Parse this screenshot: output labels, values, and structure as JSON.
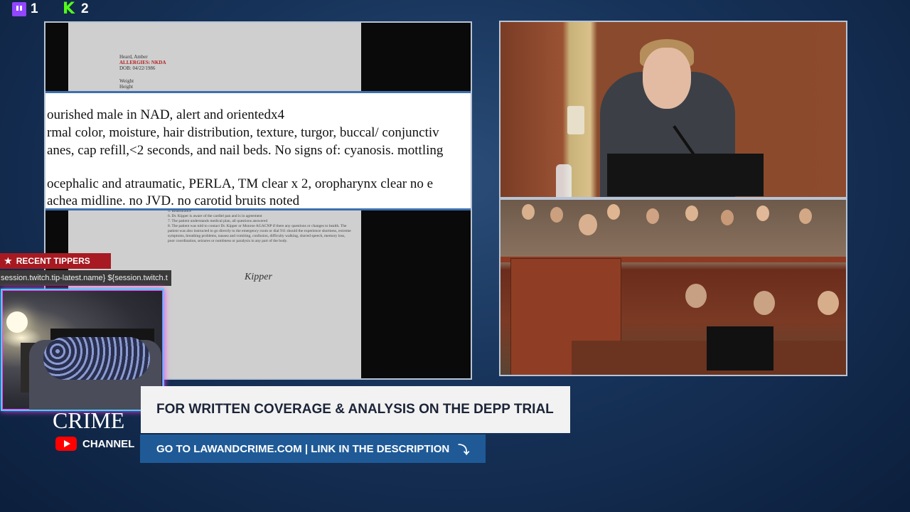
{
  "platforms": [
    {
      "name": "twitch",
      "icon": "twitch-icon",
      "count": "1",
      "color": "#9146ff"
    },
    {
      "name": "kick",
      "icon": "kick-icon",
      "count": "2",
      "color": "#53fc18"
    }
  ],
  "document": {
    "header": {
      "name": "Heard, Amber",
      "allergies": "ALLERGIES: NKDA",
      "dob": "DOB: 04/22/1986",
      "weight_label": "Weight",
      "height_label": "Height"
    },
    "zoom_lines": [
      "ourished male in NAD, alert and orientedx4",
      "rmal color, moisture, hair distribution, texture, turgor, buccal/ conjunctiv",
      "anes, cap refill,<2 seconds, and nail beds. No signs of: cyanosis. mottling",
      "ocephalic and atraumatic, PERLA, TM clear x 2, oropharynx clear no e",
      "achea midline. no JVD. no carotid bruits noted"
    ],
    "list_items": [
      "5. Reassurance",
      "6. Dr. Kipper is aware of the cardiel pan and is in agreement",
      "7. The patient understands medical plan, all questions answered",
      "8. The patient was told to contact Dr. Kipper or Monroe AGACNP if there any questions or changes to health. The patient was also instructed to go directly to the emergency room or dial 911 should the experience shortness, extreme symptoms, breathing problems, nausea and vomiting, confusion, difficulty walking, slurred speech, memory loss, poor coordination, seizures or numbness or paralysis in any part of the body."
    ],
    "signature": "Kipper"
  },
  "recent_tippers": {
    "label": "RECENT TIPPERS",
    "icon": "star-icon",
    "ticker": "session.twitch.tip-latest.name} ${session.twitch.t"
  },
  "brand": {
    "name": "CRIME",
    "channel_label": "CHANNEL",
    "icon": "youtube-icon"
  },
  "banner": {
    "headline": "FOR WRITTEN COVERAGE & ANALYSIS ON THE DEPP TRIAL",
    "cta": "GO TO LAWANDCRIME.COM | LINK IN THE DESCRIPTION",
    "cta_icon": "arrow-down-icon",
    "cta_color": "#1f5a97"
  },
  "accent_colors": {
    "tippers": "#a81a22",
    "webcam_border": "#39d5ff",
    "webcam_glow": "#ff3cf2"
  }
}
